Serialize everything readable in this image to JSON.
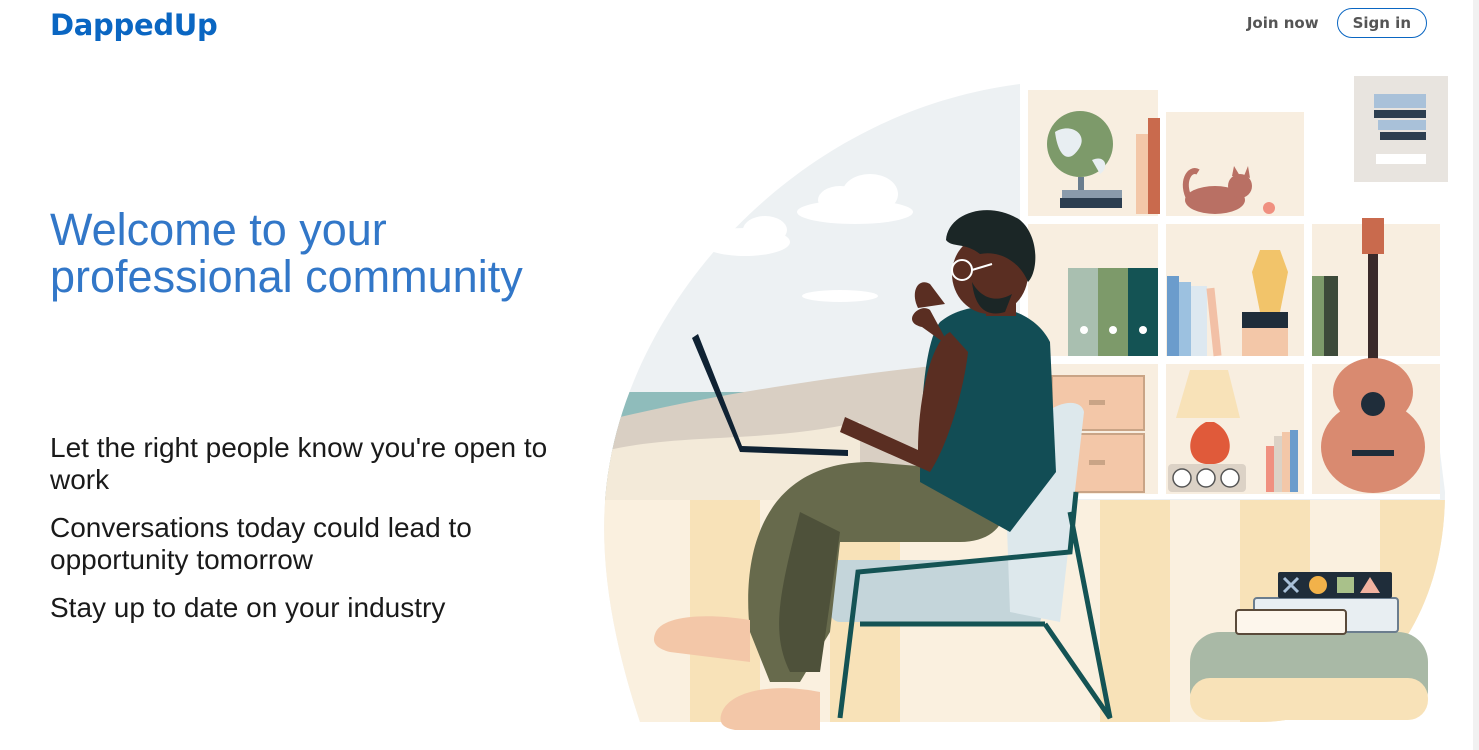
{
  "header": {
    "brand": "DappedUp",
    "join_label": "Join now",
    "signin_label": "Sign in"
  },
  "main": {
    "headline": "Welcome to your professional community",
    "points": [
      "Let the right people know you're open to work",
      "Conversations today could lead to opportunity tomorrow",
      "Stay up to date on your industry"
    ]
  },
  "colors": {
    "brand": "#0a66c2",
    "headline": "#3277c8",
    "text": "#1a1a1a"
  }
}
